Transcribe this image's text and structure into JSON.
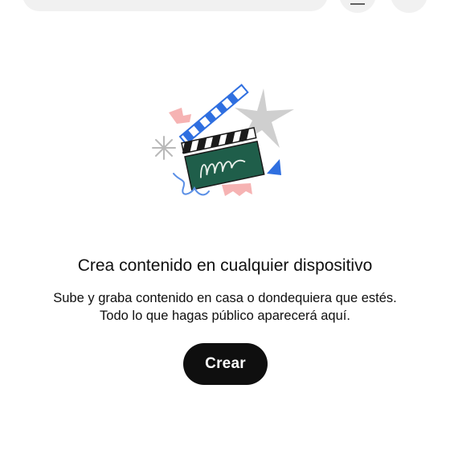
{
  "top_bar": {
    "icons": [
      "menu-icon",
      "more-icon"
    ]
  },
  "illustration": {
    "icon": "clapperboard-illustration",
    "colors": {
      "board": "#1f5e4a",
      "stripe_dark": "#1a1a1a",
      "stripe_blue": "#2f6fe0",
      "star": "#c8c8c8",
      "pink": "#f4a7a7",
      "triangle": "#2f6fe0"
    }
  },
  "empty_state": {
    "title": "Crea contenido en cualquier dispositivo",
    "description_line1": "Sube y graba contenido en casa o dondequiera que estés.",
    "description_line2": "Todo lo que hagas público aparecerá aquí.",
    "button_label": "Crear"
  },
  "colors": {
    "button_bg": "#0f0f0f",
    "button_text": "#ffffff"
  }
}
